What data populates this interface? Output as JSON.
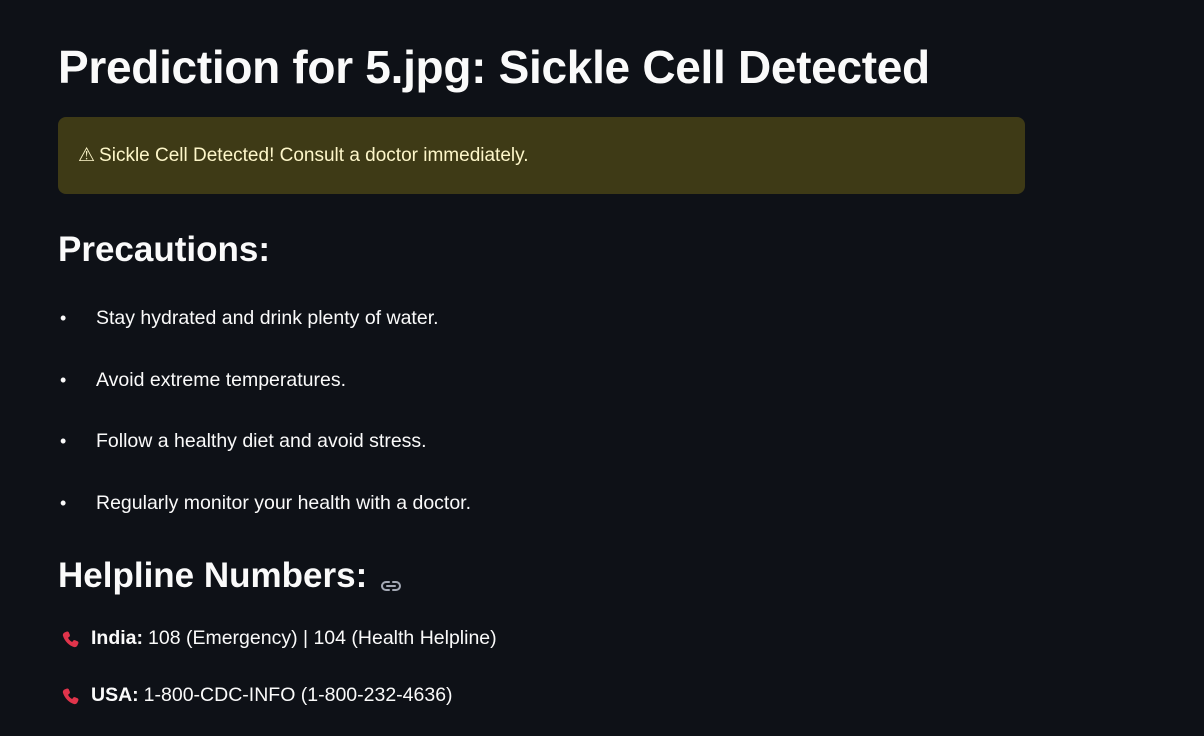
{
  "page": {
    "title": "Prediction for 5.jpg: Sickle Cell Detected"
  },
  "alert": {
    "icon": "warning-icon",
    "icon_glyph": "⚠",
    "text": "Sickle Cell Detected! Consult a doctor immediately.",
    "background": "#3e3a16",
    "text_color": "#fdf6c9"
  },
  "precautions": {
    "heading": "Precautions:",
    "items": [
      "Stay hydrated and drink plenty of water.",
      "Avoid extreme temperatures.",
      "Follow a healthy diet and avoid stress.",
      "Regularly monitor your health with a doctor."
    ]
  },
  "helpline": {
    "heading": "Helpline Numbers:",
    "anchor_icon": "link-icon",
    "entries": [
      {
        "icon": "phone-icon",
        "country": "India:",
        "numbers": "108 (Emergency) | 104 (Health Helpline)"
      },
      {
        "icon": "phone-icon",
        "country": "USA:",
        "numbers": "1-800-CDC-INFO (1-800-232-4636)"
      }
    ],
    "icon_color": "#e0344b"
  },
  "theme": {
    "background": "#0e1117",
    "text": "#fafafa"
  }
}
